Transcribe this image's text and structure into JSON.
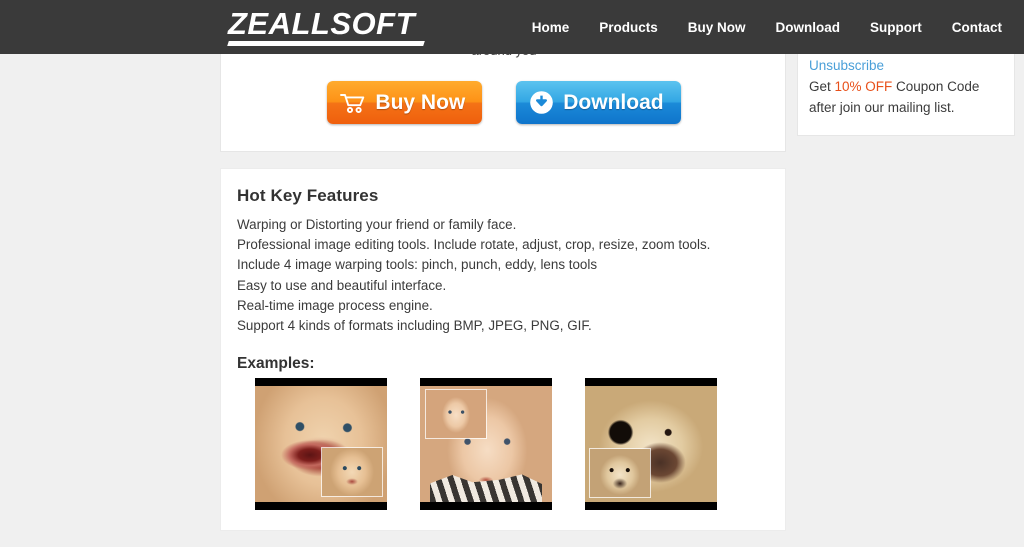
{
  "header": {
    "logo_text": "ZEALLSOFT",
    "nav": [
      {
        "label": "Home"
      },
      {
        "label": "Products"
      },
      {
        "label": "Buy Now"
      },
      {
        "label": "Download"
      },
      {
        "label": "Support"
      },
      {
        "label": "Contact"
      }
    ],
    "background_color": "#3a3a3a"
  },
  "top_panel": {
    "clipped_text": "around you",
    "buy_button": {
      "label": "Buy Now",
      "icon": "shopping-cart-icon",
      "color": "#f47216"
    },
    "download_button": {
      "label": "Download",
      "icon": "download-circle-icon",
      "color": "#1b8ad8"
    }
  },
  "sidebar": {
    "unsubscribe_label": "Unsubscribe",
    "unsubscribe_color": "#4a9fd8",
    "coupon_prefix": "Get ",
    "coupon_highlight": "10% OFF",
    "coupon_highlight_color": "#e8501a",
    "coupon_suffix": " Coupon Code after join our mailing list."
  },
  "main": {
    "features_heading": "Hot Key Features",
    "features": [
      "Warping or Distorting your friend or family face.",
      "Professional image editing tools. Include rotate, adjust, crop, resize, zoom tools.",
      "Include 4 image warping tools: pinch, punch, eddy, lens tools",
      "Easy to use and beautiful interface.",
      "Real-time image process engine.",
      "Support 4 kinds of formats including BMP, JPEG, PNG, GIF."
    ],
    "examples_heading": "Examples:",
    "examples": [
      {
        "name": "warped-baby-face-example",
        "inset_position": "bottom-right"
      },
      {
        "name": "warped-girl-face-example",
        "inset_position": "top-left"
      },
      {
        "name": "warped-bulldog-face-example",
        "inset_position": "bottom-left"
      }
    ]
  },
  "page": {
    "background_color": "#f0f0f0",
    "panel_color": "#ffffff"
  }
}
